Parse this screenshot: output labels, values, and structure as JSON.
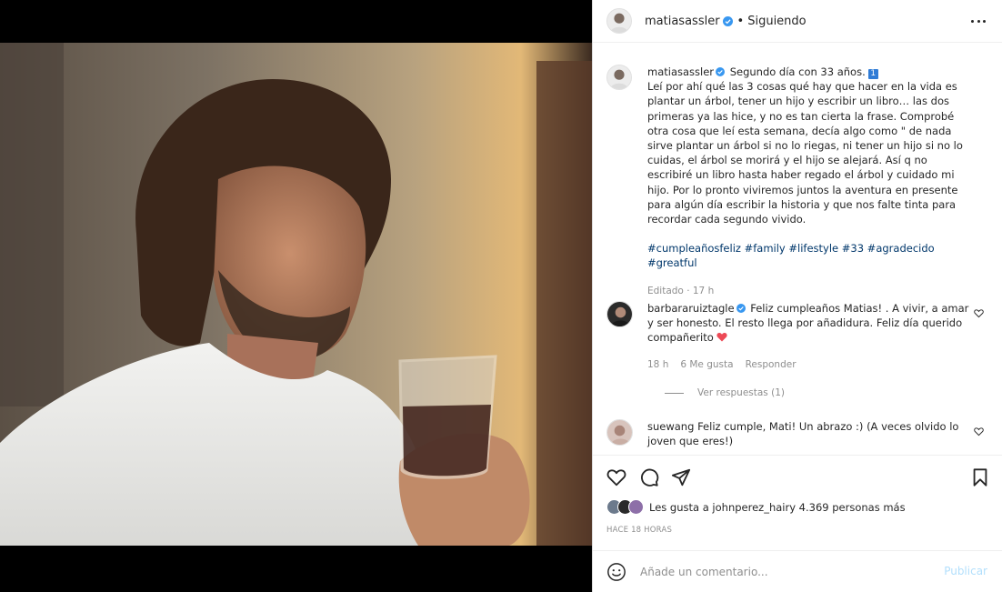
{
  "header": {
    "username": "matiasassler",
    "separator": "•",
    "follow_status": "Siguiendo"
  },
  "caption": {
    "username": "matiasassler",
    "first_line": "Segundo día con 33 años.",
    "badge": "1",
    "body": "Leí por ahí qué las 3 cosas qué hay que hacer en la vida es plantar un árbol, tener un hijo y escribir un libro… las dos primeras ya las hice, y no es tan cierta la frase. Comprobé otra cosa que leí esta semana, decía algo como \" de nada sirve plantar un árbol si no lo riegas, ni tener un hijo si no lo cuidas, el árbol se morirá y el hijo se alejará. Así q no escribiré un libro hasta haber regado el árbol y cuidado mi hijo. Por lo pronto viviremos juntos la aventura en presente para algún día escribir la historia y que nos falte tinta para recordar cada segundo vivido.",
    "hashtags": "#cumpleañosfeliz #family #lifestyle #33 #agradecido #greatful",
    "meta": "Editado · 17 h"
  },
  "comments": [
    {
      "username": "barbararuiztagle",
      "text": "Feliz cumpleaños Matias! . A vivir, a amar y ser honesto. El resto llega por añadidura. Feliz día querido compañerito",
      "time": "18 h",
      "likes": "6 Me gusta",
      "reply": "Responder",
      "view_replies": "Ver respuestas (1)"
    },
    {
      "username": "suewang",
      "text": "Feliz cumple, Mati! Un abrazo :) (A veces olvido lo joven que eres!)"
    }
  ],
  "likes_text": {
    "prefix": "Les gusta a ",
    "user": "johnperez_hair",
    "suffix": " y 4.369 personas más"
  },
  "time_ago": "HACE 18 HORAS",
  "comment_box": {
    "placeholder": "Añade un comentario...",
    "publish": "Publicar"
  },
  "icons": {
    "verified": "verified-badge-icon",
    "like": "heart-icon",
    "comment": "comment-icon",
    "share": "paper-plane-icon",
    "save": "bookmark-icon",
    "emoji": "smiley-icon",
    "more": "more-options-icon"
  },
  "colors": {
    "verified_blue": "#3897f0",
    "link_blue": "#00376b",
    "muted": "#8e8e8e",
    "publish_disabled": "#b2dffc",
    "heart_red": "#ed4956"
  }
}
